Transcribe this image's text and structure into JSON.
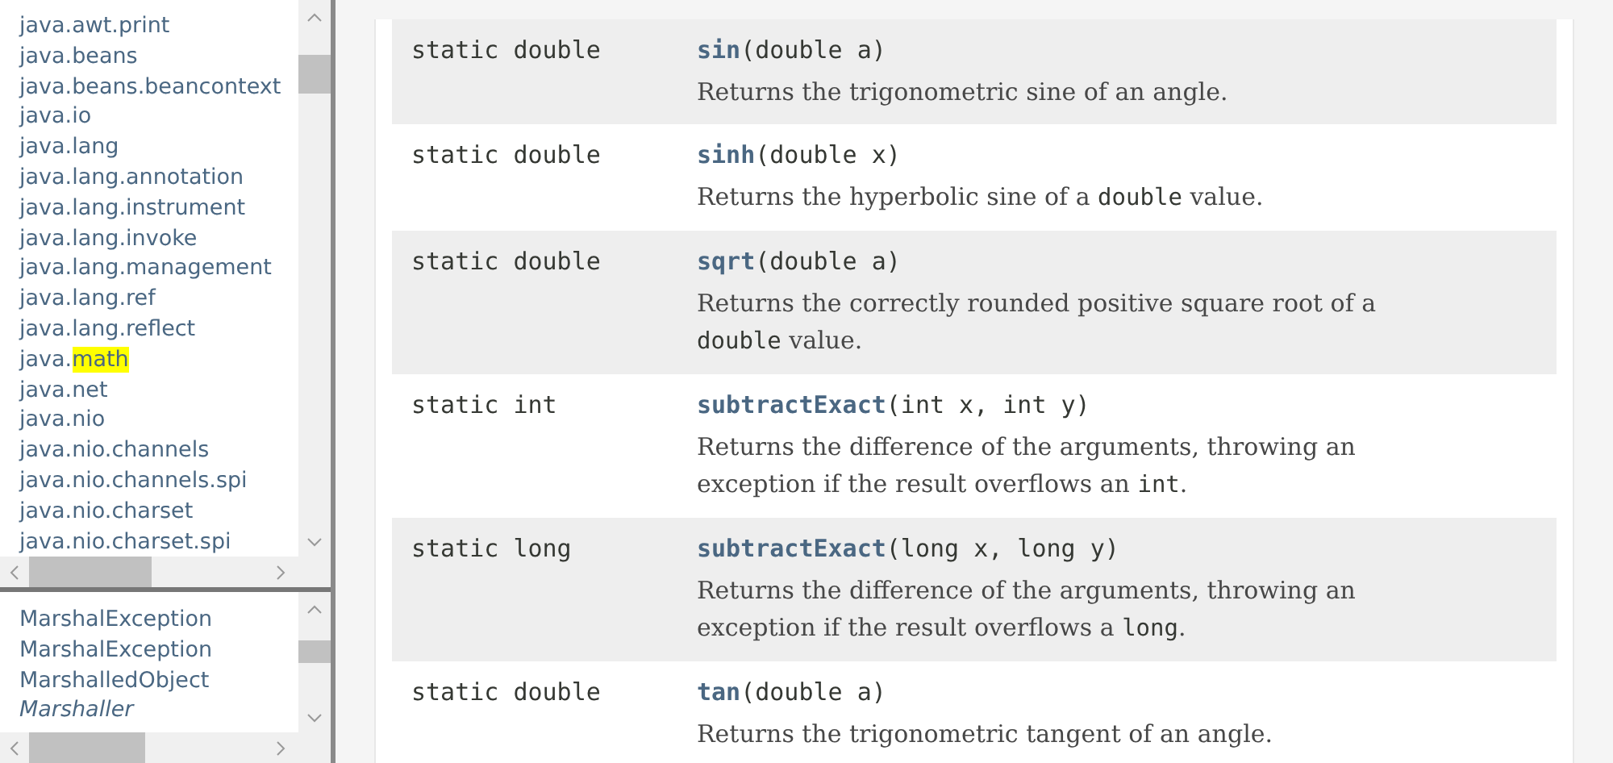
{
  "packages": [
    {
      "prefix": "java.awt.print"
    },
    {
      "prefix": "java.beans"
    },
    {
      "prefix": "java.beans.beancontext"
    },
    {
      "prefix": "java.io"
    },
    {
      "prefix": "java.lang"
    },
    {
      "prefix": "java.lang.annotation"
    },
    {
      "prefix": "java.lang.instrument"
    },
    {
      "prefix": "java.lang.invoke"
    },
    {
      "prefix": "java.lang.management"
    },
    {
      "prefix": "java.lang.ref"
    },
    {
      "prefix": "java.lang.reflect"
    },
    {
      "prefix": "java.",
      "highlight": "math"
    },
    {
      "prefix": "java.net"
    },
    {
      "prefix": "java.nio"
    },
    {
      "prefix": "java.nio.channels"
    },
    {
      "prefix": "java.nio.channels.spi"
    },
    {
      "prefix": "java.nio.charset"
    },
    {
      "prefix": "java.nio.charset.spi"
    }
  ],
  "classes": [
    {
      "label": "MarshalException",
      "kind": "class"
    },
    {
      "label": "MarshalException",
      "kind": "class"
    },
    {
      "label": "MarshalledObject",
      "kind": "class"
    },
    {
      "label": "Marshaller",
      "kind": "interface"
    }
  ],
  "methods": [
    {
      "modifier": "static double",
      "name": "sin",
      "params": "(double a)",
      "description": [
        {
          "kind": "text",
          "text": "Returns the trigonometric sine of an angle."
        }
      ]
    },
    {
      "modifier": "static double",
      "name": "sinh",
      "params": "(double x)",
      "description": [
        {
          "kind": "text",
          "text": "Returns the hyperbolic sine of a "
        },
        {
          "kind": "code",
          "text": "double"
        },
        {
          "kind": "text",
          "text": " value."
        }
      ]
    },
    {
      "modifier": "static double",
      "name": "sqrt",
      "params": "(double a)",
      "description": [
        {
          "kind": "text",
          "text": "Returns the correctly rounded positive square root of a "
        },
        {
          "kind": "code",
          "text": "double"
        },
        {
          "kind": "text",
          "text": " value."
        }
      ]
    },
    {
      "modifier": "static int",
      "name": "subtractExact",
      "params": "(int x, int y)",
      "description": [
        {
          "kind": "text",
          "text": "Returns the difference of the arguments, throwing an exception if the result overflows an "
        },
        {
          "kind": "code",
          "text": "int"
        },
        {
          "kind": "text",
          "text": "."
        }
      ]
    },
    {
      "modifier": "static long",
      "name": "subtractExact",
      "params": "(long x, long y)",
      "description": [
        {
          "kind": "text",
          "text": "Returns the difference of the arguments, throwing an exception if the result overflows a "
        },
        {
          "kind": "code",
          "text": "long"
        },
        {
          "kind": "text",
          "text": "."
        }
      ]
    },
    {
      "modifier": "static double",
      "name": "tan",
      "params": "(double a)",
      "description": [
        {
          "kind": "text",
          "text": "Returns the trigonometric tangent of an angle."
        }
      ]
    }
  ]
}
